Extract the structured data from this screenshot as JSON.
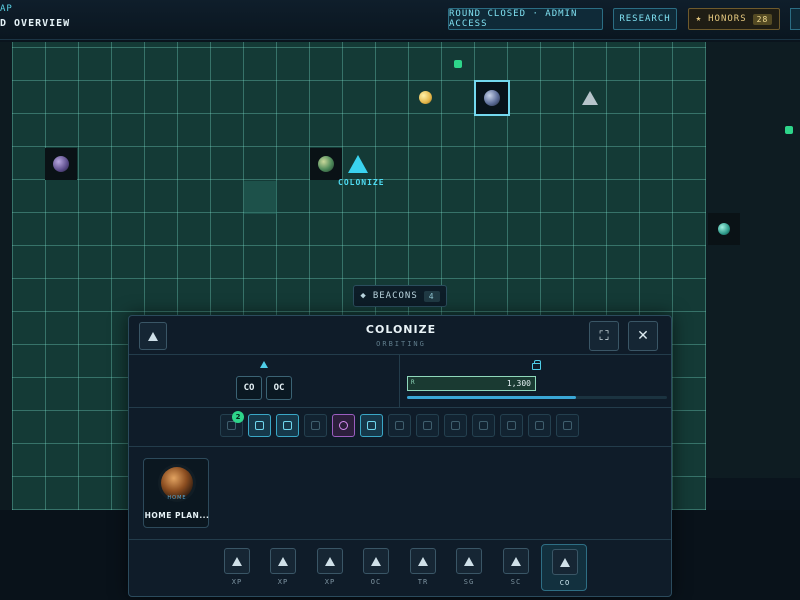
{
  "header": {
    "crumb_top": "AP",
    "crumb_main": "D OVERVIEW",
    "round_status": "ROUND CLOSED · ADMIN ACCESS",
    "research_label": "RESEARCH",
    "honors_icon": "star-icon",
    "honors_label": "HONORS",
    "honors_count": "28"
  },
  "map": {
    "colonize_label": "COLONIZE",
    "beacons_label": "BEACONS",
    "beacons_count": "4"
  },
  "panel": {
    "title": "COLONIZE",
    "subtitle": "ORBITING",
    "codes": [
      "CO",
      "OC"
    ],
    "resource_letter": "R",
    "resource_value": "1,300",
    "progress": 0.65,
    "tool_badge": "2",
    "home_card": {
      "tag": "HOME",
      "label": "HOME PLAN..."
    },
    "bottom_buttons": [
      "XP",
      "XP",
      "XP",
      "OC",
      "TR",
      "SG",
      "SC",
      "CO"
    ],
    "active_bottom": "CO"
  },
  "colors": {
    "accent": "#3ad3ef",
    "grid": "#143a36",
    "green": "#2ed58a",
    "gold": "#e3c77f"
  }
}
